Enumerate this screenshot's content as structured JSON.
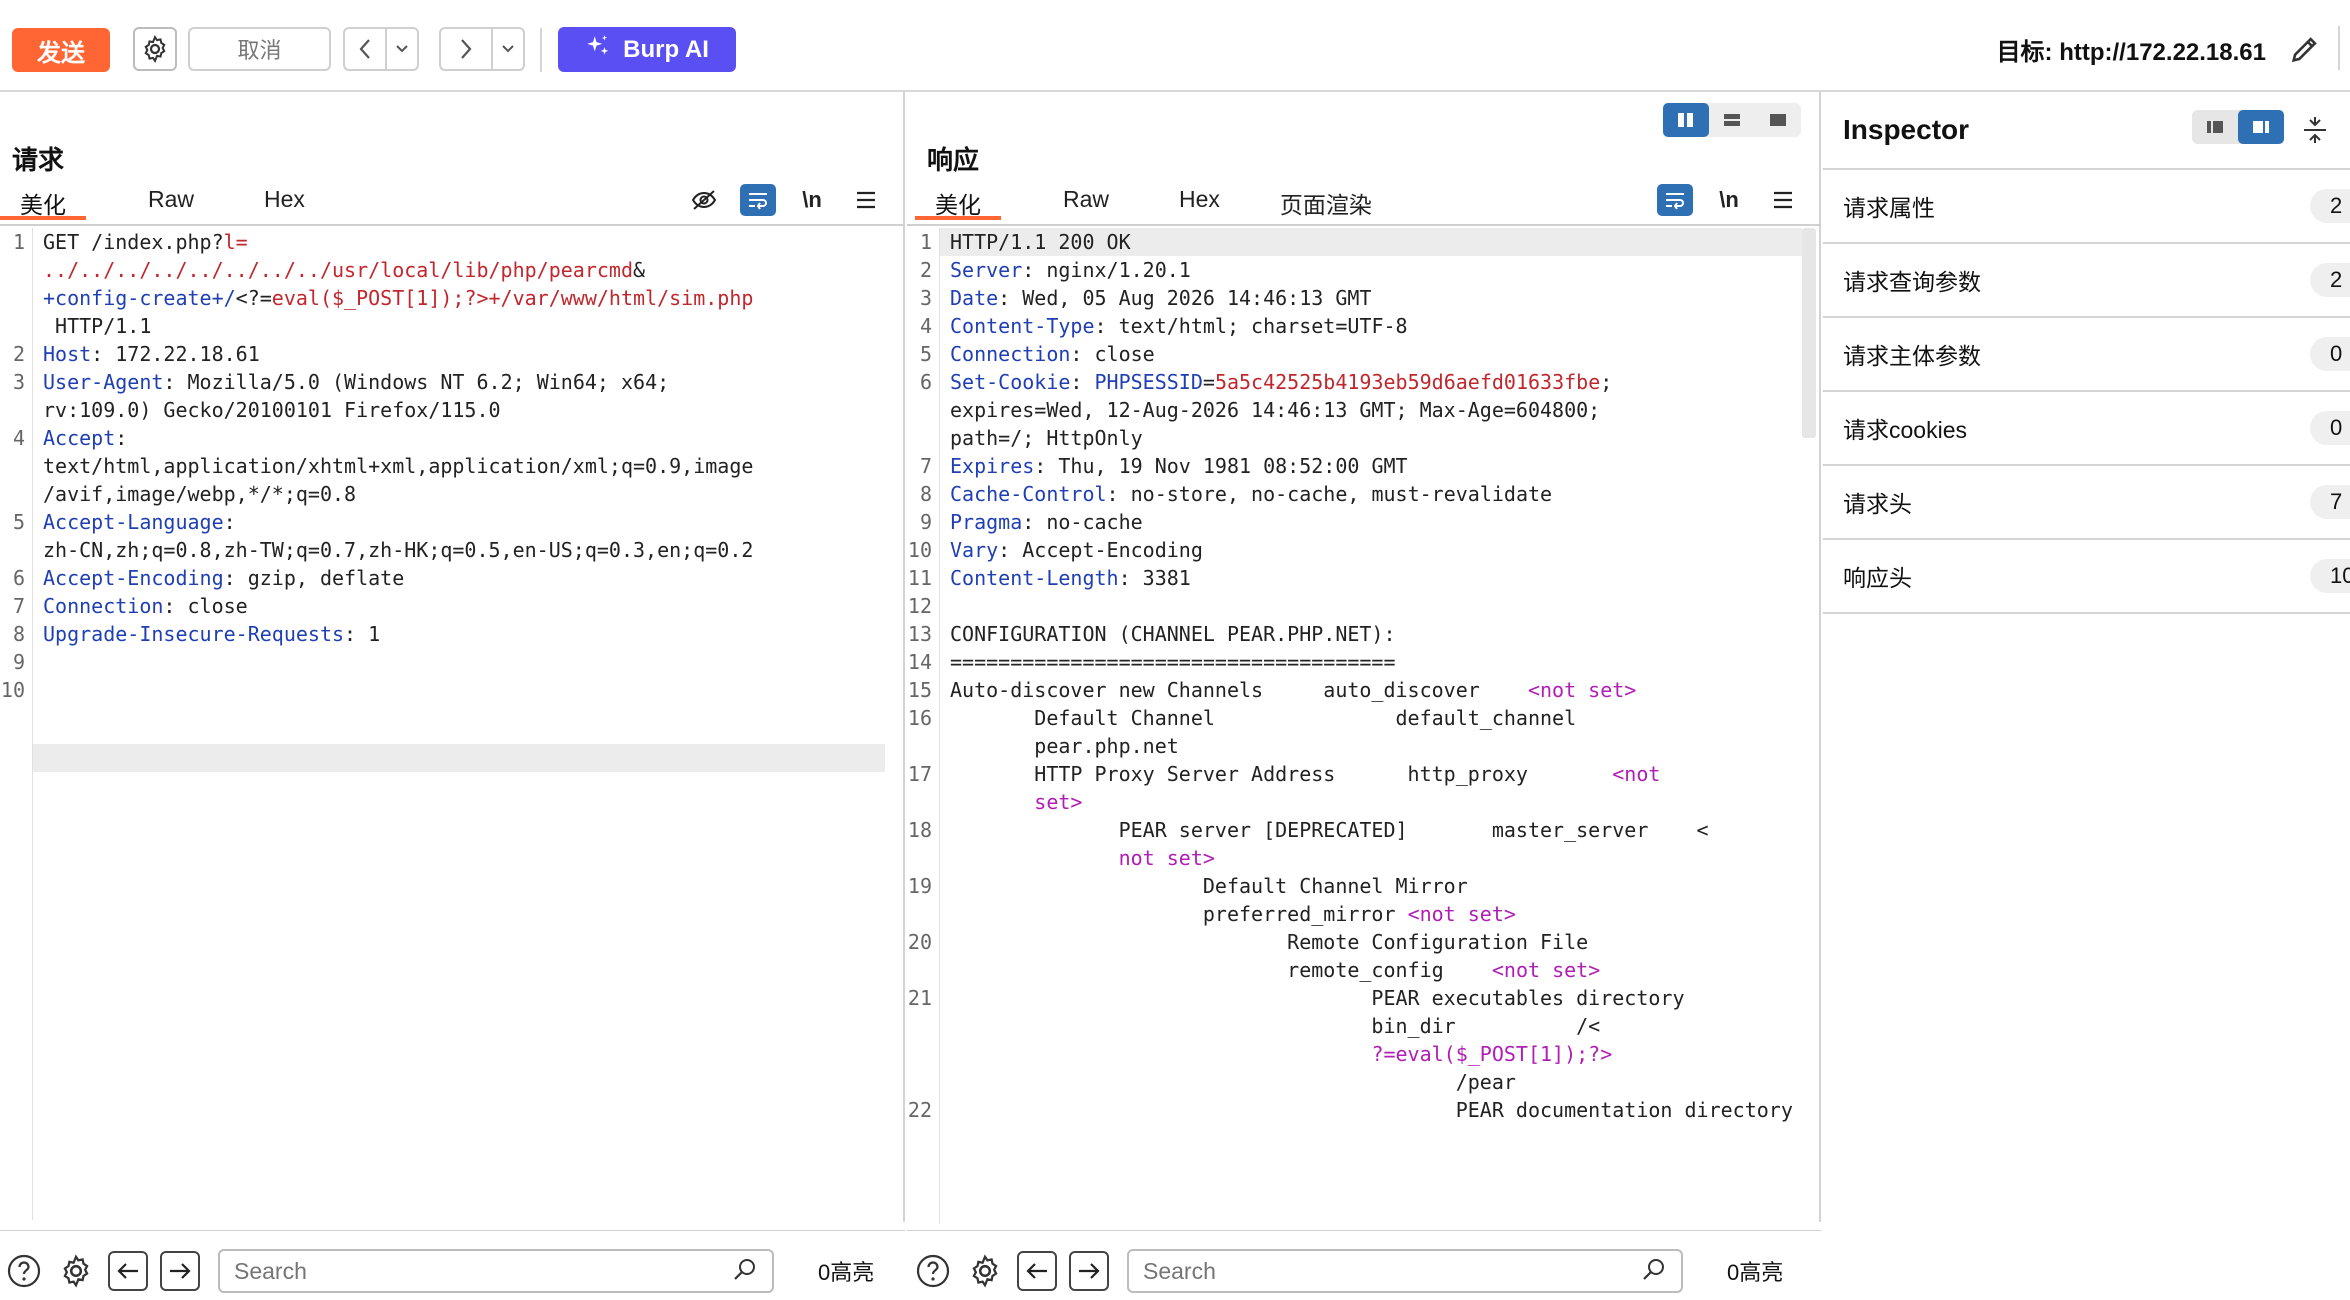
{
  "toolbar": {
    "send_label": "发送",
    "cancel_label": "取消",
    "burp_ai_label": "Burp AI",
    "target_label": "目标: http://172.22.18.61"
  },
  "request": {
    "title": "请求",
    "tabs": [
      "美化",
      "Raw",
      "Hex"
    ],
    "line_numbers": [
      "1",
      "2",
      "3",
      "4",
      "5",
      "6",
      "7",
      "8",
      "9",
      "10"
    ],
    "search_placeholder": "Search",
    "highlight_count": "0高亮"
  },
  "response": {
    "title": "响应",
    "tabs": [
      "美化",
      "Raw",
      "Hex",
      "页面渲染"
    ],
    "line_numbers": [
      "1",
      "2",
      "3",
      "4",
      "5",
      "6",
      "7",
      "8",
      "9",
      "10",
      "11",
      "12",
      "13",
      "14",
      "15",
      "16",
      "17",
      "18",
      "19",
      "20",
      "21",
      "22"
    ],
    "search_placeholder": "Search",
    "highlight_count": "0高亮"
  },
  "inspector": {
    "title": "Inspector",
    "rows": [
      {
        "label": "请求属性",
        "count": "2"
      },
      {
        "label": "请求查询参数",
        "count": "2"
      },
      {
        "label": "请求主体参数",
        "count": "0"
      },
      {
        "label": "请求cookies",
        "count": "0"
      },
      {
        "label": "请求头",
        "count": "7"
      },
      {
        "label": "响应头",
        "count": "10"
      }
    ]
  },
  "colors": {
    "accent": "#ff6633",
    "ai_button": "#5a4ff3",
    "toggle_blue": "#2f6fb3",
    "header_name": "#1f3fb3",
    "request_path": "#c1272d",
    "magenta": "#b01eb5"
  },
  "icons": [
    "gear-icon",
    "chevron-left-icon",
    "chevron-down-icon",
    "chevron-right-icon",
    "sparkle-icon",
    "pencil-icon",
    "hide-icon",
    "wrap-icon",
    "newline-icon",
    "menu-icon",
    "help-icon",
    "arrow-left-icon",
    "arrow-right-icon",
    "search-icon",
    "layout-icon",
    "collapse-icon"
  ]
}
